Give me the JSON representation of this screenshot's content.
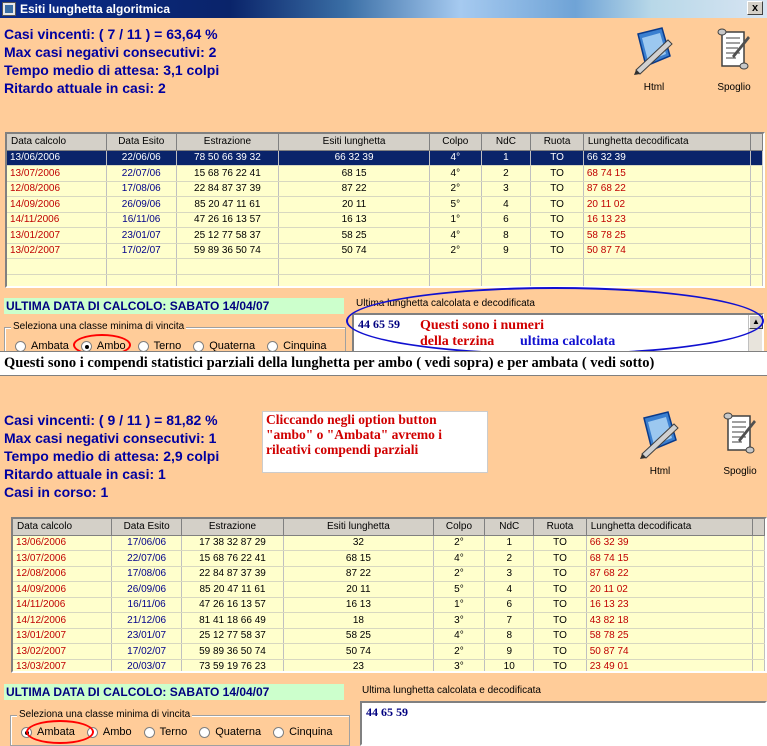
{
  "window": {
    "title": "Esiti lunghetta algoritmica",
    "close_label": "x"
  },
  "colors": {
    "panel_bg": "#ffcc99",
    "stats_text": "#0000a0",
    "row_red": "#c00000",
    "row_blue": "#00008b",
    "selected_row": "#0a246a",
    "grid_row_bg": "#ffffcc",
    "section_bg": "#ccffcc"
  },
  "toolbar": {
    "html_label": "Html",
    "spoglio_label": "Spoglio"
  },
  "top": {
    "stats": [
      "Casi vincenti: ( 7 / 11 ) = 63,64 %",
      "Max casi negativi consecutivi: 2",
      "Tempo medio di attesa: 3,1 colpi",
      "Ritardo attuale in casi: 2"
    ],
    "columns": [
      "Data calcolo",
      "Data Esito",
      "Estrazione",
      "Esiti lunghetta",
      "Colpo",
      "NdC",
      "Ruota",
      "Lunghetta decodificata"
    ],
    "rows": [
      [
        "13/06/2006",
        "22/06/06",
        "78 50 66 39 32",
        "66 32 39",
        "4°",
        "1",
        "TO",
        "66 32 39"
      ],
      [
        "13/07/2006",
        "22/07/06",
        "15 68 76 22 41",
        "68 15",
        "4°",
        "2",
        "TO",
        "68 74 15"
      ],
      [
        "12/08/2006",
        "17/08/06",
        "22 84 87 37 39",
        "87 22",
        "2°",
        "3",
        "TO",
        "87 68 22"
      ],
      [
        "14/09/2006",
        "26/09/06",
        "85 20 47 11 61",
        "20 11",
        "5°",
        "4",
        "TO",
        "20 11 02"
      ],
      [
        "14/11/2006",
        "16/11/06",
        "47 26 16 13 57",
        "16 13",
        "1°",
        "6",
        "TO",
        "16 13 23"
      ],
      [
        "13/01/2007",
        "23/01/07",
        "25 12 77 58 37",
        "58 25",
        "4°",
        "8",
        "TO",
        "58 78 25"
      ],
      [
        "13/02/2007",
        "17/02/07",
        "59 89 36 50 74",
        "50 74",
        "2°",
        "9",
        "TO",
        "50 87 74"
      ]
    ],
    "section_title": "ULTIMA DATA DI CALCOLO: SABATO 14/04/07",
    "last_label": "Ultima lunghetta calcolata e decodificata",
    "last_value": "44 65 59",
    "group_label": "Seleziona una classe minima di vincita",
    "radios": [
      "Ambata",
      "Ambo",
      "Terno",
      "Quaterna",
      "Cinquina"
    ],
    "selected_radio": "Ambo"
  },
  "annotations": {
    "numbers_line1": "Questi sono i numeri",
    "numbers_line2": "della terzina",
    "numbers_line3": "ultima calcolata",
    "band": "Questi sono i compendi statistici parziali della lunghetta per  ambo ( vedi sopra) e per ambata ( vedi sotto)",
    "options_note": "Cliccando negli option button \"ambo\" o \"Ambata\" avremo i rileativi compendi parziali"
  },
  "bottom": {
    "stats": [
      "Casi vincenti: ( 9 / 11 ) = 81,82 %",
      "Max casi negativi consecutivi: 1",
      "Tempo medio di attesa: 2,9 colpi",
      "Ritardo attuale in casi: 1",
      "Casi in corso: 1"
    ],
    "columns": [
      "Data calcolo",
      "Data Esito",
      "Estrazione",
      "Esiti lunghetta",
      "Colpo",
      "NdC",
      "Ruota",
      "Lunghetta decodificata"
    ],
    "rows": [
      [
        "13/06/2006",
        "17/06/06",
        "17 38 32 87 29",
        "32",
        "2°",
        "1",
        "TO",
        "66 32 39"
      ],
      [
        "13/07/2006",
        "22/07/06",
        "15 68 76 22 41",
        "68 15",
        "4°",
        "2",
        "TO",
        "68 74 15"
      ],
      [
        "12/08/2006",
        "17/08/06",
        "22 84 87 37 39",
        "87 22",
        "2°",
        "3",
        "TO",
        "87 68 22"
      ],
      [
        "14/09/2006",
        "26/09/06",
        "85 20 47 11 61",
        "20 11",
        "5°",
        "4",
        "TO",
        "20 11 02"
      ],
      [
        "14/11/2006",
        "16/11/06",
        "47 26 16 13 57",
        "16 13",
        "1°",
        "6",
        "TO",
        "16 13 23"
      ],
      [
        "14/12/2006",
        "21/12/06",
        "81 41 18 66 49",
        "18",
        "3°",
        "7",
        "TO",
        "43 82 18"
      ],
      [
        "13/01/2007",
        "23/01/07",
        "25 12 77 58 37",
        "58 25",
        "4°",
        "8",
        "TO",
        "58 78 25"
      ],
      [
        "13/02/2007",
        "17/02/07",
        "59 89 36 50 74",
        "50 74",
        "2°",
        "9",
        "TO",
        "50 87 74"
      ],
      [
        "13/03/2007",
        "20/03/07",
        "73 59 19 76 23",
        "23",
        "3°",
        "10",
        "TO",
        "23 49 01"
      ]
    ],
    "section_title": "ULTIMA DATA DI CALCOLO: SABATO 14/04/07",
    "last_label": "Ultima lunghetta calcolata e decodificata",
    "last_value": "44 65 59",
    "group_label": "Seleziona una classe minima di vincita",
    "radios": [
      "Ambata",
      "Ambo",
      "Terno",
      "Quaterna",
      "Cinquina"
    ],
    "selected_radio": "Ambata"
  }
}
